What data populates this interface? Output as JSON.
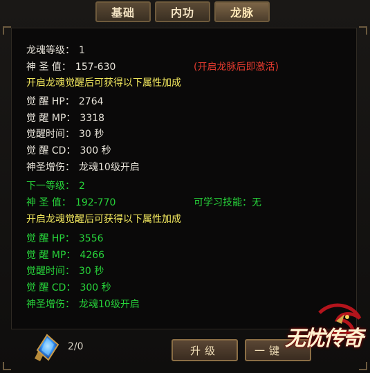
{
  "tabs": [
    {
      "label": "基础"
    },
    {
      "label": "内功"
    },
    {
      "label": "龙脉"
    }
  ],
  "current": {
    "level_label": "龙魂等级：",
    "level_value": "1",
    "sacred_label": "神 圣 值：",
    "sacred_value": "157-630",
    "notice": "(开启龙脉后即激活)",
    "bonus_header": "开启龙魂觉醒后可获得以下属性加成",
    "hp_label": "觉 醒 HP：",
    "hp_value": "2764",
    "mp_label": "觉 醒 MP：",
    "mp_value": "3318",
    "time_label": "觉醒时间：",
    "time_value": "30 秒",
    "cd_label": "觉 醒 CD：",
    "cd_value": "300 秒",
    "dmg_label": "神圣增伤：",
    "dmg_value": "龙魂10级开启"
  },
  "next": {
    "level_label": "下一等级：",
    "level_value": "2",
    "sacred_label": "神 圣 值：",
    "sacred_value": "192-770",
    "skill_label": "可学习技能：",
    "skill_value": "无",
    "bonus_header": "开启龙魂觉醒后可获得以下属性加成",
    "hp_label": "觉 醒 HP：",
    "hp_value": "3556",
    "mp_label": "觉 醒 MP：",
    "mp_value": "4266",
    "time_label": "觉醒时间：",
    "time_value": "30 秒",
    "cd_label": "觉 醒 CD：",
    "cd_value": "300 秒",
    "dmg_label": "神圣增伤：",
    "dmg_value": "龙魂10级开启"
  },
  "footer": {
    "item_icon": "blue-gem-icon",
    "count": "2/0",
    "upgrade_label": "升级",
    "onekey_label": "一键",
    "logo_text": "无忧传奇"
  },
  "colors": {
    "white_text": "#e8e4da",
    "yellow_text": "#f2e85e",
    "green_text": "#27d33a",
    "red_text": "#e43a2e"
  }
}
